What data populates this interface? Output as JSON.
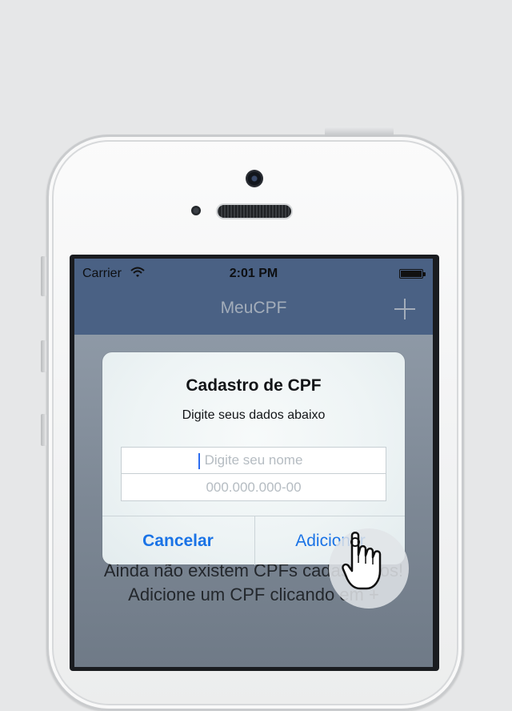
{
  "status_bar": {
    "carrier": "Carrier",
    "time": "2:01 PM"
  },
  "nav": {
    "title": "MeuCPF"
  },
  "empty_state": {
    "line1": "Ainda não existem CPFs cadastrados!",
    "line2": "Adicione um CPF clicando em +"
  },
  "dialog": {
    "title": "Cadastro de CPF",
    "message": "Digite seus dados abaixo",
    "name_placeholder": "Digite seu nome",
    "cpf_placeholder": "000.000.000-00",
    "cancel_label": "Cancelar",
    "add_label": "Adicionar"
  },
  "colors": {
    "accent": "#1a73e6",
    "navbar": "#4a6184",
    "caret": "#2c6cf0"
  },
  "icons": [
    "wifi-icon",
    "battery-icon",
    "add-icon",
    "hand-pointer-icon"
  ]
}
